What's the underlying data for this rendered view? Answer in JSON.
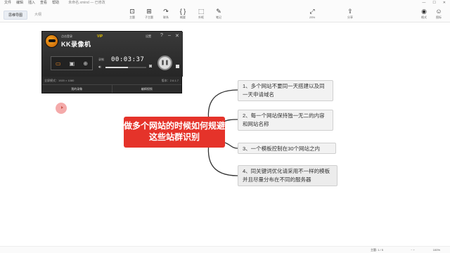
{
  "menu": {
    "items": [
      "文件",
      "编辑",
      "插入",
      "查看",
      "帮助"
    ],
    "doc_title": "未命名.xmind — 已修改"
  },
  "toolbar": {
    "view_tabs": [
      "思维导图",
      "大纲"
    ],
    "tools_left": [
      {
        "icon": "topic-icon",
        "label": "主题"
      },
      {
        "icon": "subtopic-icon",
        "label": "子主题"
      },
      {
        "icon": "relationship-icon",
        "label": "联系"
      },
      {
        "icon": "summary-icon",
        "label": "概要"
      },
      {
        "icon": "boundary-icon",
        "label": "外框"
      },
      {
        "icon": "note-icon",
        "label": "笔记"
      }
    ],
    "zen_label": "ZEN",
    "share_label": "分享",
    "format_label": "格式",
    "icon_label": "图标"
  },
  "kk_recorder": {
    "login_text": "点击登录",
    "vip": "VIP",
    "app_name": "KK录像机",
    "settings": "设置",
    "recording_label": "录制",
    "time": "00:03:37",
    "volume_level": 0.55,
    "screen_mode": "全屏模式：1920 × 1080",
    "version": "版本：2.6.1.7",
    "btn_my_videos": "我的录象",
    "btn_edit_video": "编辑视频"
  },
  "mindmap": {
    "central": "做多个网站的时候如何规避这些站群识别",
    "branches": [
      "1、多个网站不要同一天搭建以及同一天申请域名",
      "2、每一个网站保持独一无二的内容和网站名称",
      "3、一个模板控制在30个网站之内",
      "4、同关键词优化请采用不一样的模板并且尽量分布在不同的服务器"
    ]
  },
  "status": {
    "topic_count": "主题: 1 / 5",
    "zoom": "100%"
  }
}
